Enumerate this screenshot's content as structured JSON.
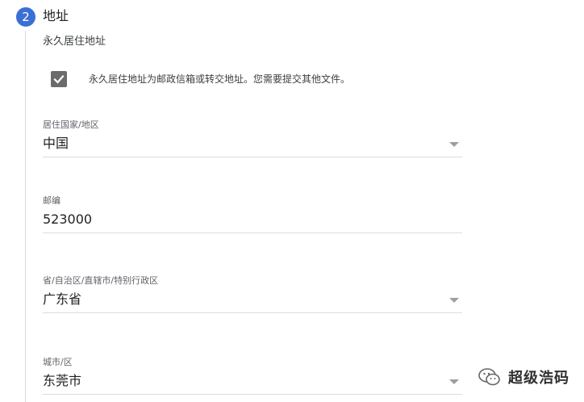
{
  "step": {
    "number": "2",
    "title": "地址"
  },
  "address": {
    "heading": "永久居住地址",
    "mailing_checkbox": {
      "label": "永久居住地址为邮政信箱或转交地址。您需要提交其他文件。",
      "checked": true
    },
    "fields": {
      "country": {
        "label": "居住国家/地区",
        "value": "中国"
      },
      "postal_code": {
        "label": "邮编",
        "value": "523000"
      },
      "province": {
        "label": "省/自治区/直辖市/特别行政区",
        "value": "广东省"
      },
      "city": {
        "label": "城市/区",
        "value": "东莞市"
      }
    }
  },
  "watermark": {
    "text": "超级浩码",
    "icon": "wechat-icon"
  },
  "colors": {
    "accent": "#3b6fd4",
    "checkbox": "#6b6b6b",
    "divider": "#dadce0"
  }
}
